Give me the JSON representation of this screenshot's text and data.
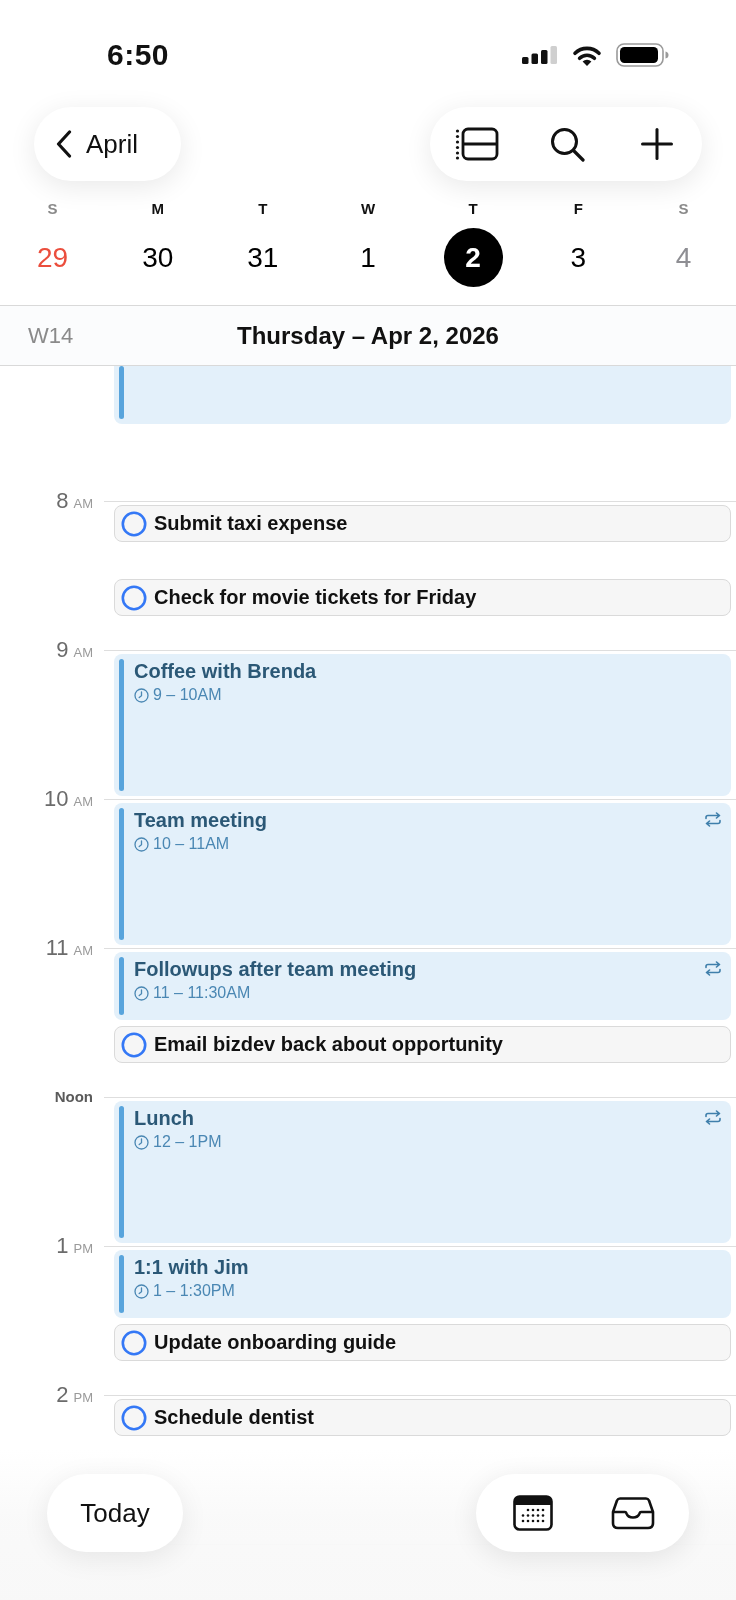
{
  "status_bar": {
    "time": "6:50"
  },
  "toolbar": {
    "back_label": "April"
  },
  "week_strip": {
    "days": [
      {
        "weekday": "S",
        "date": "29",
        "weekend": true,
        "selected": false,
        "color": "#eb4e3d"
      },
      {
        "weekday": "M",
        "date": "30",
        "weekend": false,
        "selected": false,
        "color": "#000000"
      },
      {
        "weekday": "T",
        "date": "31",
        "weekend": false,
        "selected": false,
        "color": "#000000"
      },
      {
        "weekday": "W",
        "date": "1",
        "weekend": false,
        "selected": false,
        "color": "#000000"
      },
      {
        "weekday": "T",
        "date": "2",
        "weekend": false,
        "selected": true,
        "color": "#000000"
      },
      {
        "weekday": "F",
        "date": "3",
        "weekend": false,
        "selected": false,
        "color": "#000000"
      },
      {
        "weekday": "S",
        "date": "4",
        "weekend": true,
        "selected": false,
        "color": "#8e8e93"
      }
    ]
  },
  "day_header": {
    "week": "W14",
    "title": "Thursday – Apr 2, 2026"
  },
  "timeline": {
    "slots": [
      {
        "kind": "partial",
        "items": [
          {
            "kind": "event"
          }
        ]
      },
      {
        "kind": "hour",
        "hour": "8",
        "meridiem": "AM",
        "items": [
          {
            "kind": "task",
            "title": "Submit taxi expense",
            "completed": false
          },
          {
            "kind": "task",
            "title": "Check for movie tickets for Friday",
            "completed": false
          }
        ]
      },
      {
        "kind": "hour",
        "hour": "9",
        "meridiem": "AM",
        "items": [
          {
            "kind": "event",
            "title": "Coffee with Brenda",
            "time": "9 – 10AM",
            "repeats": false
          }
        ]
      },
      {
        "kind": "hour",
        "hour": "10",
        "meridiem": "AM",
        "items": [
          {
            "kind": "event",
            "title": "Team meeting",
            "time": "10 – 11AM",
            "repeats": true
          }
        ]
      },
      {
        "kind": "hour",
        "hour": "11",
        "meridiem": "AM",
        "items": [
          {
            "kind": "event",
            "title": "Followups after team meeting",
            "time": "11 – 11:30AM",
            "repeats": true
          },
          {
            "kind": "task",
            "title": "Email bizdev back about opportunity",
            "completed": false
          }
        ]
      },
      {
        "kind": "hour",
        "hour": "Noon",
        "items": [
          {
            "kind": "event",
            "title": "Lunch",
            "time": "12 – 1PM",
            "repeats": true
          }
        ]
      },
      {
        "kind": "hour",
        "hour": "1",
        "meridiem": "PM",
        "items": [
          {
            "kind": "event",
            "title": "1:1 with Jim",
            "time": "1 – 1:30PM",
            "repeats": false
          },
          {
            "kind": "task",
            "title": "Update onboarding guide",
            "completed": false
          }
        ]
      },
      {
        "kind": "hour",
        "hour": "2",
        "meridiem": "PM",
        "items": [
          {
            "kind": "task",
            "title": "Schedule dentist",
            "completed": false
          }
        ]
      }
    ]
  },
  "bottom_bar": {
    "today_label": "Today"
  }
}
